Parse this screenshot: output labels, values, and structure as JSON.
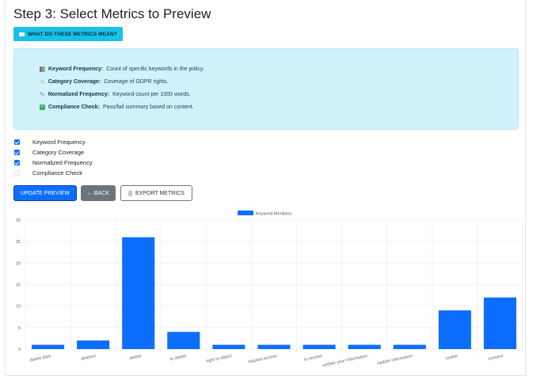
{
  "page": {
    "title": "Step 3: Select Metrics to Preview",
    "help_button": "WHAT DO THESE METRICS MEAN?"
  },
  "info_box": {
    "items": [
      {
        "icon": "bar-chart-icon",
        "label": "Keyword Frequency:",
        "text": "Count of specific keywords in the policy."
      },
      {
        "icon": "sparkle-icon",
        "label": "Category Coverage:",
        "text": "Coverage of GDPR rights."
      },
      {
        "icon": "pencil-icon",
        "label": "Normalized Frequency:",
        "text": "Keyword count per 1000 words."
      },
      {
        "icon": "check-box-icon",
        "label": "Compliance Check:",
        "text": "Pass/fail summary based on content."
      }
    ]
  },
  "metrics": [
    {
      "label": "Keyword Frequency",
      "checked": true
    },
    {
      "label": "Category Coverage",
      "checked": true
    },
    {
      "label": "Normalized Frequency",
      "checked": true
    },
    {
      "label": "Compliance Check",
      "checked": false
    }
  ],
  "buttons": {
    "update": "UPDATE PREVIEW",
    "back": "← BACK",
    "export": "EXPORT METRICS"
  },
  "colors": {
    "primary": "#0d6efd",
    "info": "#17c1e8",
    "info_bg": "#d1f2fb",
    "secondary": "#6c757d",
    "bar": "#0d6efd"
  },
  "chart_data": {
    "type": "bar",
    "categories": [
      "delete data",
      "deletion",
      "delete",
      "to delete",
      "right to object",
      "request access",
      "to access",
      "update your information",
      "update information",
      "cookie",
      "consent"
    ],
    "series": [
      {
        "name": "Keyword Mentions",
        "values": [
          1,
          2,
          26,
          4,
          1,
          1,
          1,
          1,
          1,
          9,
          12
        ]
      }
    ],
    "ylim": [
      0,
      30
    ],
    "yticks": [
      0,
      5,
      10,
      15,
      20,
      25,
      30
    ],
    "grid": true,
    "legend": "top-center"
  }
}
